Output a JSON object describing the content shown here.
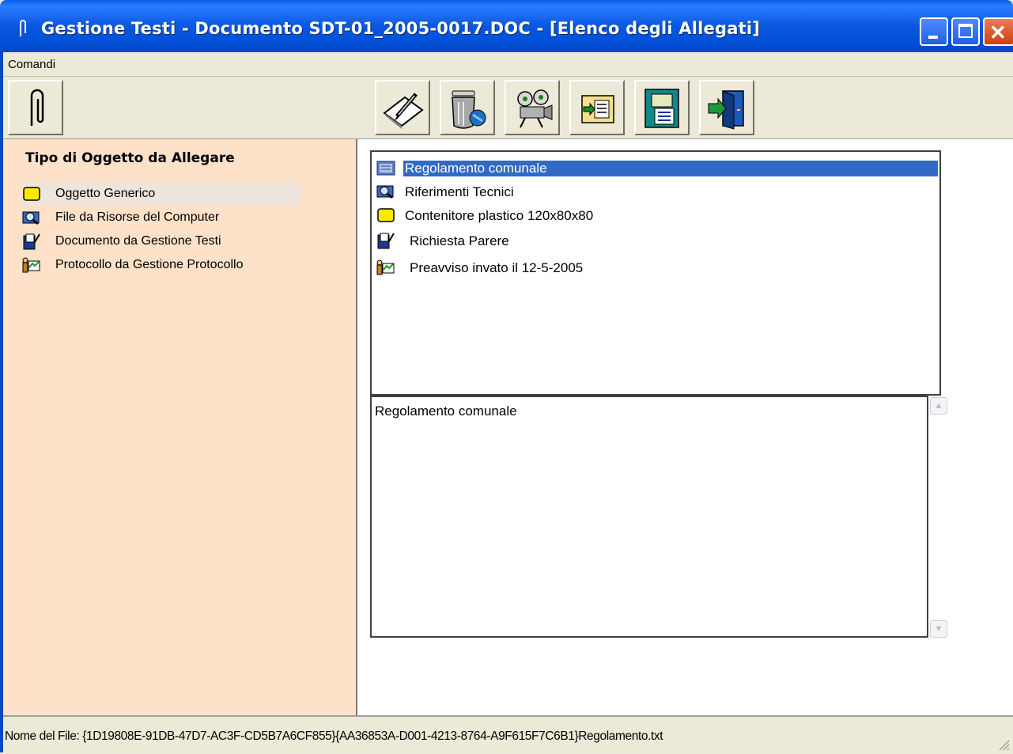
{
  "window": {
    "title": "Gestione Testi - Documento SDT-01_2005-0017.DOC - [Elenco degli Allegati]",
    "controls": [
      "minimize",
      "maximize",
      "close"
    ]
  },
  "menu": {
    "items": [
      {
        "label": "Comandi"
      }
    ]
  },
  "toolbar": {
    "buttons": [
      {
        "name": "attach",
        "icon": "paperclip-icon"
      },
      {
        "name": "edit",
        "icon": "pen-paper-icon"
      },
      {
        "name": "delete",
        "icon": "trash-bin-icon"
      },
      {
        "name": "view",
        "icon": "projector-icon"
      },
      {
        "name": "insert",
        "icon": "insert-document-icon"
      },
      {
        "name": "details",
        "icon": "document-list-icon"
      },
      {
        "name": "exit",
        "icon": "exit-door-icon"
      }
    ]
  },
  "left_panel": {
    "title": "Tipo di Oggetto da Allegare",
    "items": [
      {
        "label": "Oggetto Generico",
        "icon": "yellow-box-icon",
        "selected": true
      },
      {
        "label": "File da Risorse del Computer",
        "icon": "magnifier-file-icon"
      },
      {
        "label": "Documento da Gestione Testi",
        "icon": "document-icon"
      },
      {
        "label": "Protocollo da Gestione Protocollo",
        "icon": "protocol-icon"
      }
    ]
  },
  "attachments": {
    "items": [
      {
        "label": "Regolamento comunale",
        "icon": "file-text-icon",
        "selected": true
      },
      {
        "label": "Riferimenti Tecnici",
        "icon": "magnifier-file-icon"
      },
      {
        "label": "Contenitore plastico 120x80x80",
        "icon": "yellow-box-icon"
      },
      {
        "label": "Richiesta Parere",
        "icon": "document-icon"
      },
      {
        "label": "Preavviso invato il 12-5-2005",
        "icon": "protocol-icon"
      }
    ],
    "description": "Regolamento comunale"
  },
  "status": {
    "text": "Nome del File: {1D19808E-91DB-47D7-AC3F-CD5B7A6CF855}{AA36853A-D001-4213-8764-A9F615F7C6B1}Regolamento.txt"
  }
}
